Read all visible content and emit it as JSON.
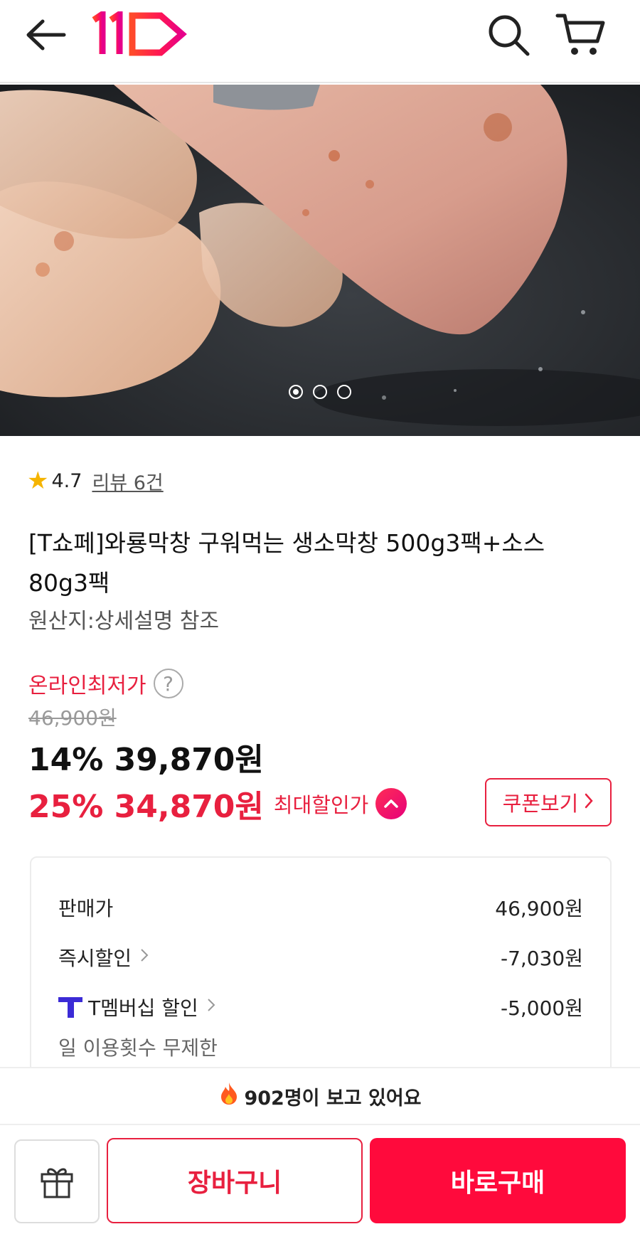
{
  "header": {
    "back_icon": "arrow-left-icon",
    "logo_text": "11",
    "search_icon": "search-icon",
    "cart_icon": "cart-icon"
  },
  "gallery": {
    "image_count": 3,
    "active_index": 0
  },
  "product": {
    "rating": "4.7",
    "review_link": "리뷰 6건",
    "title": "[T쇼페]와룡막창 구워먹는 생소막창 500g3팩+소스 80g3팩",
    "origin": "원산지:상세설명 참조"
  },
  "pricing": {
    "lowest_label": "온라인최저가",
    "help_symbol": "?",
    "original_price": "46,900원",
    "price_line_1": "14% 39,870원",
    "price_line_2": "25% 34,870원",
    "max_discount_label": "최대할인가",
    "coupon_button": "쿠폰보기",
    "accent_color": "#e8203f"
  },
  "breakdown": {
    "rows": [
      {
        "label": "판매가",
        "amount": "46,900원"
      },
      {
        "label": "즉시할인",
        "amount": "-7,030원"
      },
      {
        "label": "T멤버십 할인",
        "amount": "-5,000원"
      }
    ],
    "note": "일 이용횟수 무제한"
  },
  "viewers": {
    "icon": "fire-icon",
    "text": "902명이 보고 있어요"
  },
  "actions": {
    "gift_icon": "gift-icon",
    "cart_button": "장바구니",
    "buy_button": "바로구매",
    "buy_color": "#ff0a3c"
  }
}
